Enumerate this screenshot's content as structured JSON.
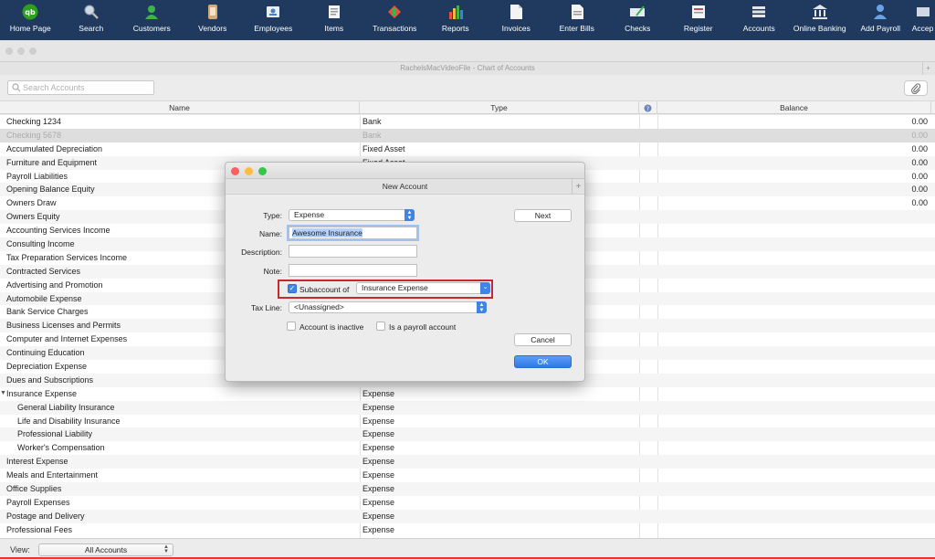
{
  "toolbar": {
    "items": [
      {
        "label": "Home Page",
        "icon": "quickbooks-logo-icon"
      },
      {
        "label": "Search",
        "icon": "magnifier-icon"
      },
      {
        "label": "Customers",
        "icon": "customer-icon"
      },
      {
        "label": "Vendors",
        "icon": "vendor-icon"
      },
      {
        "label": "Employees",
        "icon": "employee-badge-icon"
      },
      {
        "label": "Items",
        "icon": "items-icon"
      },
      {
        "label": "Transactions",
        "icon": "transactions-icon"
      },
      {
        "label": "Reports",
        "icon": "bar-chart-icon"
      },
      {
        "label": "Invoices",
        "icon": "invoice-icon"
      },
      {
        "label": "Enter Bills",
        "icon": "bill-icon"
      },
      {
        "label": "Checks",
        "icon": "check-icon"
      },
      {
        "label": "Register",
        "icon": "register-icon"
      },
      {
        "label": "Accounts",
        "icon": "accounts-icon"
      },
      {
        "label": "Online Banking",
        "icon": "bank-icon"
      },
      {
        "label": "Add Payroll",
        "icon": "add-payroll-icon"
      },
      {
        "label": "Accep",
        "icon": "accept-icon"
      }
    ]
  },
  "window": {
    "title": "RachelsMacVideoFile - Chart of Accounts"
  },
  "search": {
    "placeholder": "Search Accounts"
  },
  "table": {
    "headers": {
      "name": "Name",
      "type": "Type",
      "balance": "Balance"
    },
    "rows": [
      {
        "name": "Checking 1234",
        "type": "Bank",
        "balance": "0.00"
      },
      {
        "name": "Checking 5678",
        "type": "Bank",
        "balance": "0.00"
      },
      {
        "name": "Accumulated Depreciation",
        "type": "Fixed Asset",
        "balance": "0.00"
      },
      {
        "name": "Furniture and Equipment",
        "type": "Fixed Asset",
        "balance": "0.00"
      },
      {
        "name": "Payroll Liabilities",
        "type": "",
        "balance": "0.00"
      },
      {
        "name": "Opening Balance Equity",
        "type": "",
        "balance": "0.00"
      },
      {
        "name": "Owners Draw",
        "type": "",
        "balance": "0.00"
      },
      {
        "name": "Owners Equity",
        "type": "",
        "balance": ""
      },
      {
        "name": "Accounting Services Income",
        "type": "",
        "balance": ""
      },
      {
        "name": "Consulting Income",
        "type": "",
        "balance": ""
      },
      {
        "name": "Tax Preparation Services Income",
        "type": "",
        "balance": ""
      },
      {
        "name": "Contracted Services",
        "type": "",
        "balance": ""
      },
      {
        "name": "Advertising and Promotion",
        "type": "",
        "balance": ""
      },
      {
        "name": "Automobile Expense",
        "type": "",
        "balance": ""
      },
      {
        "name": "Bank Service Charges",
        "type": "",
        "balance": ""
      },
      {
        "name": "Business Licenses and Permits",
        "type": "",
        "balance": ""
      },
      {
        "name": "Computer and Internet Expenses",
        "type": "",
        "balance": ""
      },
      {
        "name": "Continuing Education",
        "type": "",
        "balance": ""
      },
      {
        "name": "Depreciation Expense",
        "type": "",
        "balance": ""
      },
      {
        "name": "Dues and Subscriptions",
        "type": "",
        "balance": ""
      },
      {
        "name": "Insurance Expense",
        "type": "Expense",
        "balance": ""
      },
      {
        "name": "General Liability Insurance",
        "type": "Expense",
        "balance": ""
      },
      {
        "name": "Life and Disability Insurance",
        "type": "Expense",
        "balance": ""
      },
      {
        "name": "Professional Liability",
        "type": "Expense",
        "balance": ""
      },
      {
        "name": "Worker's Compensation",
        "type": "Expense",
        "balance": ""
      },
      {
        "name": "Interest Expense",
        "type": "Expense",
        "balance": ""
      },
      {
        "name": "Meals and Entertainment",
        "type": "Expense",
        "balance": ""
      },
      {
        "name": "Office Supplies",
        "type": "Expense",
        "balance": ""
      },
      {
        "name": "Payroll Expenses",
        "type": "Expense",
        "balance": ""
      },
      {
        "name": "Postage and Delivery",
        "type": "Expense",
        "balance": ""
      },
      {
        "name": "Professional Fees",
        "type": "Expense",
        "balance": ""
      }
    ]
  },
  "footer": {
    "view_label": "View:",
    "view_value": "All Accounts"
  },
  "dialog": {
    "title": "New Account",
    "type_label": "Type:",
    "type_value": "Expense",
    "name_label": "Name:",
    "name_value": "Awesome Insurance",
    "description_label": "Description:",
    "note_label": "Note:",
    "subaccount_label": "Subaccount of",
    "subaccount_value": "Insurance Expense",
    "taxline_label": "Tax Line:",
    "taxline_value": "<Unassigned>",
    "inactive_label": "Account is inactive",
    "payroll_label": "Is a payroll account",
    "next_label": "Next",
    "cancel_label": "Cancel",
    "ok_label": "OK"
  },
  "colors": {
    "toolbar_bg": "#1f3a5e",
    "accent": "#3f84e8",
    "highlight_outline": "#c8272d"
  }
}
